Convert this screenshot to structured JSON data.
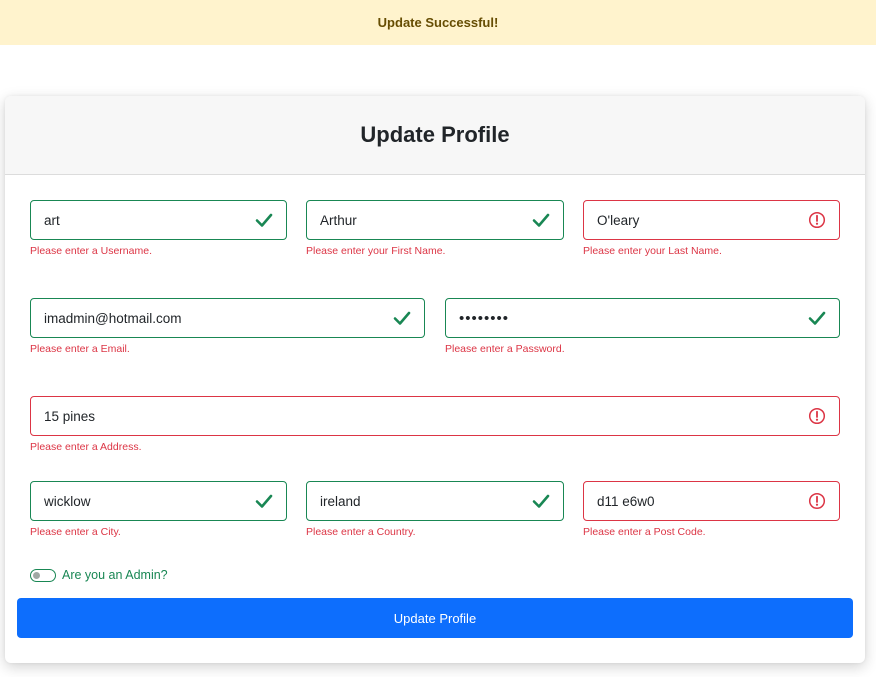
{
  "alert": {
    "message": "Update Successful!"
  },
  "form": {
    "title": "Update Profile",
    "fields": {
      "username": {
        "value": "art",
        "valid": true,
        "feedback": "Please enter a Username."
      },
      "first_name": {
        "value": "Arthur",
        "valid": true,
        "feedback": "Please enter your First Name."
      },
      "last_name": {
        "value": "O'leary",
        "valid": false,
        "feedback": "Please enter your Last Name."
      },
      "email": {
        "value": "imadmin@hotmail.com",
        "valid": true,
        "feedback": "Please enter a Email."
      },
      "password": {
        "value": "••••••••",
        "valid": true,
        "feedback": "Please enter a Password."
      },
      "address": {
        "value": "15 pines",
        "valid": false,
        "feedback": "Please enter a Address."
      },
      "city": {
        "value": "wicklow",
        "valid": true,
        "feedback": "Please enter a City."
      },
      "country": {
        "value": "ireland",
        "valid": true,
        "feedback": "Please enter a Country."
      },
      "post_code": {
        "value": "d11 e6w0",
        "valid": false,
        "feedback": "Please enter a Post Code."
      }
    },
    "admin_toggle": {
      "label": "Are you an Admin?",
      "checked": false
    },
    "submit_label": "Update Profile"
  },
  "icons": {
    "valid": "check-icon",
    "invalid": "error-circle-icon"
  },
  "colors": {
    "valid": "#198754",
    "invalid": "#dc3545",
    "primary": "#0d6efd",
    "alert_bg": "#fff3cd"
  }
}
